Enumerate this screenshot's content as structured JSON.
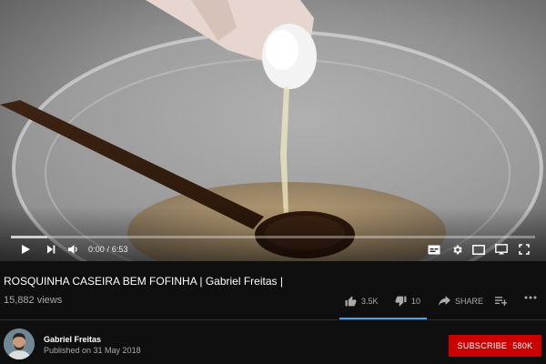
{
  "player": {
    "current_time": "0:00",
    "duration": "6:53",
    "time_display": "0:00 / 6:53",
    "buffered_fraction": 0.07
  },
  "video": {
    "title": "ROSQUINHA CASEIRA BEM FOFINHA | Gabriel Freitas |",
    "views": "15,882 views"
  },
  "actions": {
    "likes": "3.5K",
    "dislikes": "10",
    "share_label": "SHARE",
    "like_fraction": 0.997
  },
  "channel": {
    "name": "Gabriel Freitas",
    "published": "Published on 31 May 2018",
    "subscribe_label": "SUBSCRIBE",
    "subscriber_count": "580K"
  },
  "colors": {
    "background": "#0f0f0f",
    "subscribe": "#cc0000",
    "sentiment_bar": "#3ea6ff",
    "secondary_text": "#aaaaaa"
  }
}
